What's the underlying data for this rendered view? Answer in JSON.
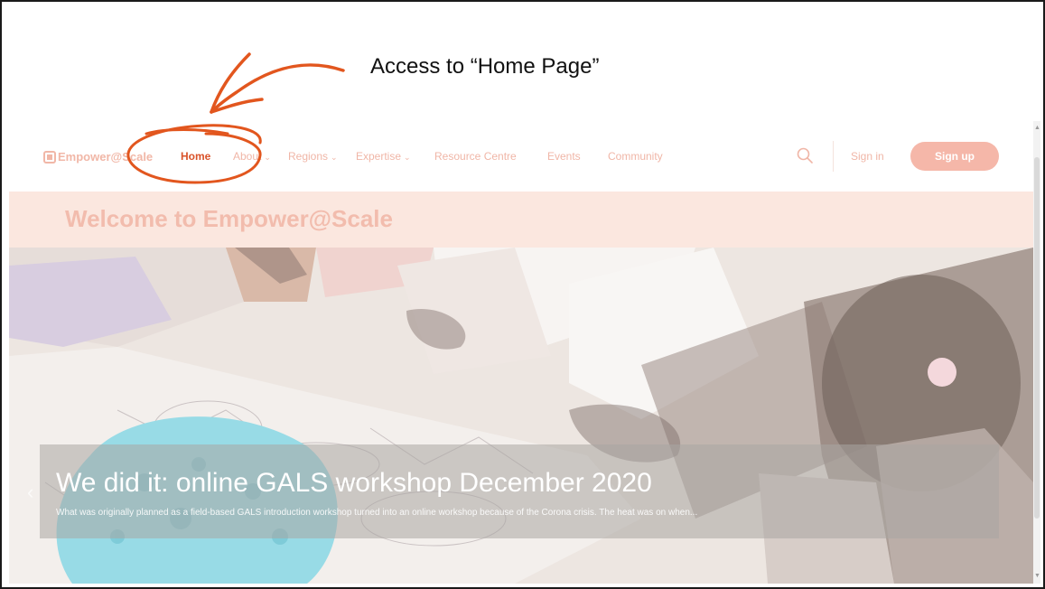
{
  "annotation": {
    "callout": "Access to “Home Page”"
  },
  "site": {
    "logo_text": "Empower@Scale",
    "nav": {
      "home": "Home",
      "about": "About",
      "regions": "Regions",
      "expertise": "Expertise",
      "resource_centre": "Resource Centre",
      "events": "Events",
      "community": "Community"
    },
    "sign_in": "Sign in",
    "sign_up": "Sign up",
    "welcome": "Welcome to Empower@Scale"
  },
  "slide": {
    "title": "We did it: online GALS workshop December 2020",
    "excerpt": "What was originally planned as a field-based GALS introduction workshop turned into an online workshop because of the Corona crisis. The heat was on when..."
  },
  "icons": {
    "search": "search-icon",
    "chevron": "chevron-down-icon",
    "prev": "chevron-left-icon"
  },
  "colors": {
    "accent": "#d9532a",
    "annotation": "#e2561e",
    "faded_brand": "#f5b7a9"
  }
}
